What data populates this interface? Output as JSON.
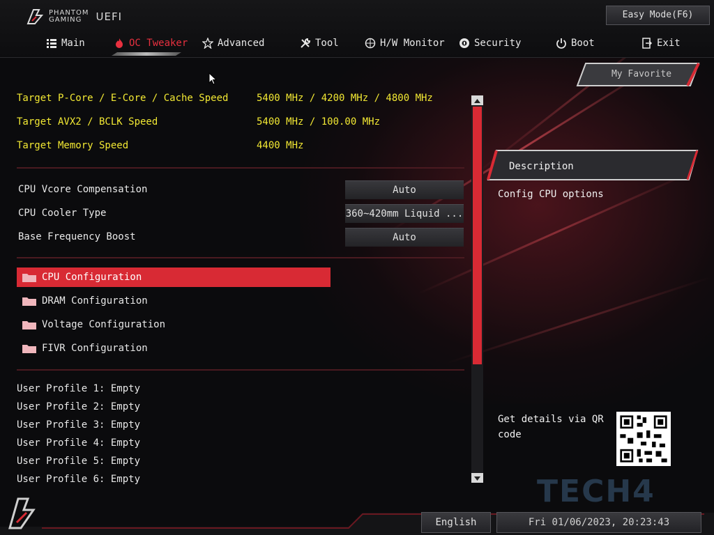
{
  "header": {
    "brand_line1": "PHANTOM",
    "brand_line2": "GAMING",
    "brand_uefi": "UEFI",
    "easy_mode": "Easy Mode(F6)"
  },
  "nav": {
    "items": [
      {
        "label": "Main",
        "icon": "list-icon"
      },
      {
        "label": "OC Tweaker",
        "icon": "flame-icon",
        "active": true
      },
      {
        "label": "Advanced",
        "icon": "star-icon"
      },
      {
        "label": "Tool",
        "icon": "wrench-icon"
      },
      {
        "label": "H/W Monitor",
        "icon": "monitor-icon"
      },
      {
        "label": "Security",
        "icon": "shield-icon"
      },
      {
        "label": "Boot",
        "icon": "power-icon"
      },
      {
        "label": "Exit",
        "icon": "exit-icon"
      }
    ]
  },
  "favorite": "My Favorite",
  "targets": [
    {
      "label": "Target P-Core / E-Core / Cache Speed",
      "value": "5400 MHz / 4200 MHz / 4800 MHz"
    },
    {
      "label": "Target AVX2 / BCLK Speed",
      "value": "5400 MHz / 100.00 MHz"
    },
    {
      "label": "Target Memory Speed",
      "value": "4400 MHz"
    }
  ],
  "options": [
    {
      "label": "CPU Vcore Compensation",
      "value": "Auto"
    },
    {
      "label": "CPU Cooler Type",
      "value": "360~420mm Liquid ..."
    },
    {
      "label": "Base Frequency Boost",
      "value": "Auto"
    }
  ],
  "submenus": [
    {
      "label": "CPU Configuration",
      "selected": true
    },
    {
      "label": "DRAM Configuration"
    },
    {
      "label": "Voltage Configuration"
    },
    {
      "label": "FIVR Configuration"
    }
  ],
  "profiles": [
    "User Profile 1: Empty",
    "User Profile 2: Empty",
    "User Profile 3: Empty",
    "User Profile 4: Empty",
    "User Profile 5: Empty",
    "User Profile 6: Empty"
  ],
  "description": {
    "title": "Description",
    "text": "Config CPU options",
    "qr_text": "Get details via QR code"
  },
  "footer": {
    "language": "English",
    "datetime": "Fri 01/06/2023, 20:23:43"
  },
  "watermark": "TECH4",
  "colors": {
    "accent": "#d82a34",
    "target_text": "#f2e833",
    "background": "#0b0b0d"
  }
}
